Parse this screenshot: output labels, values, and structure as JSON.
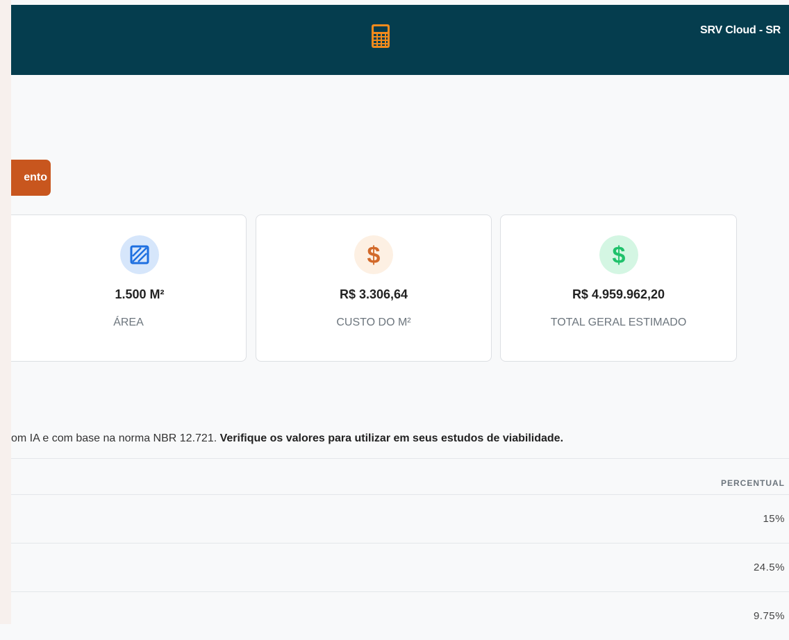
{
  "header": {
    "brand": "SRV Cloud - SR",
    "icon": "calculator-icon",
    "background_color": "#053d4e",
    "icon_color": "#f08a1c"
  },
  "action_button": {
    "label": "ento",
    "color": "#c8561e"
  },
  "cards": [
    {
      "icon": "area-hatch-icon",
      "value": "1.500 M²",
      "label": "ÁREA",
      "icon_color": "#1d6fe0"
    },
    {
      "icon": "dollar-icon",
      "value": "R$ 3.306,64",
      "label": "CUSTO DO M²",
      "icon_color": "#d2692a"
    },
    {
      "icon": "dollar-icon",
      "value": "R$ 4.959.962,20",
      "label": "TOTAL GERAL ESTIMADO",
      "icon_color": "#1fc16b"
    }
  ],
  "note": {
    "text": "om IA e com base na norma NBR 12.721. ",
    "bold": "Verifique os valores para utilizar em seus estudos de viabilidade."
  },
  "table": {
    "header_percentual": "PERCENTUAL",
    "rows": [
      {
        "percent": "15%"
      },
      {
        "percent": "24.5%"
      },
      {
        "percent": "9.75%"
      }
    ]
  }
}
